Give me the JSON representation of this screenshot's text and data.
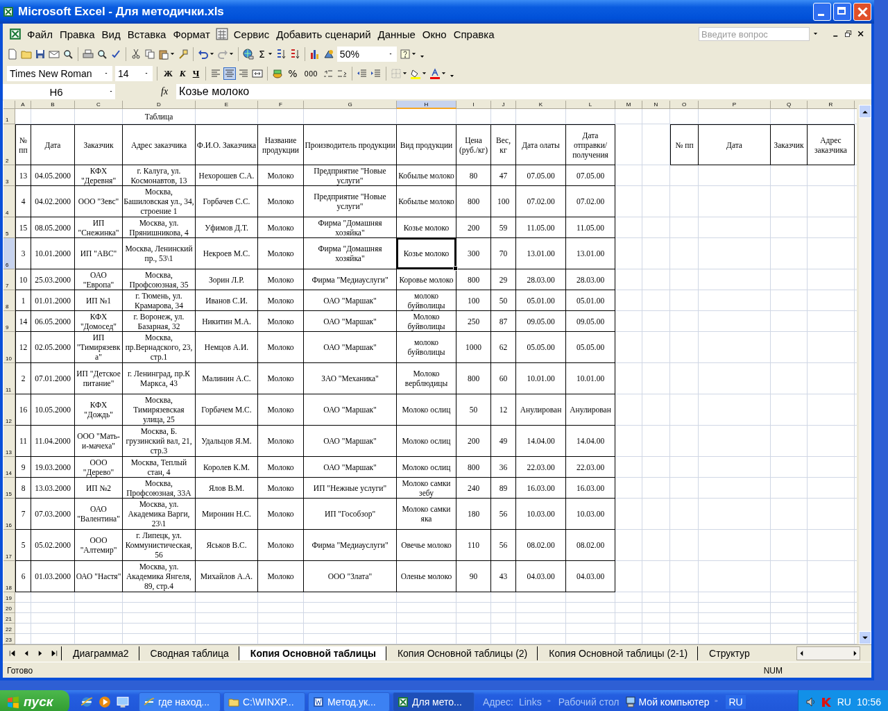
{
  "window": {
    "title": "Microsoft Excel - Для методички.xls"
  },
  "menu": [
    {
      "kind": "item",
      "label": "Файл"
    },
    {
      "kind": "item",
      "label": "Правка"
    },
    {
      "kind": "item",
      "label": "Вид"
    },
    {
      "kind": "item",
      "label": "Вставка"
    },
    {
      "kind": "item",
      "label": "Формат"
    },
    {
      "kind": "icon"
    },
    {
      "kind": "item",
      "label": "Сервис"
    },
    {
      "kind": "item",
      "label": "Добавить сценарий"
    },
    {
      "kind": "item",
      "label": "Данные"
    },
    {
      "kind": "item",
      "label": "Окно"
    },
    {
      "kind": "item",
      "label": "Справка"
    }
  ],
  "help_field": {
    "placeholder": "Введите вопрос"
  },
  "standard_toolbar": {
    "autosum": "Σ",
    "zoom": "50%"
  },
  "formatting_toolbar": {
    "font": "Times New Roman",
    "size": "14",
    "styles": [
      "Ж",
      "К",
      "Ч"
    ],
    "align": [
      {
        "selected": false
      },
      {
        "selected": true
      },
      {
        "selected": false
      }
    ],
    "percent": "%",
    "thousands": "000"
  },
  "formula_bar": {
    "cell": "H6",
    "fx": "fx",
    "value": "Козье молоко"
  },
  "columns": [
    {
      "label": "A",
      "selected": false
    },
    {
      "label": "B",
      "selected": false
    },
    {
      "label": "C",
      "selected": false
    },
    {
      "label": "D",
      "selected": false
    },
    {
      "label": "E",
      "selected": false
    },
    {
      "label": "F",
      "selected": false
    },
    {
      "label": "G",
      "selected": false
    },
    {
      "label": "H",
      "selected": true
    },
    {
      "label": "I",
      "selected": false
    },
    {
      "label": "J",
      "selected": false
    },
    {
      "label": "K",
      "selected": false
    },
    {
      "label": "L",
      "selected": false
    },
    {
      "label": "M",
      "selected": false
    },
    {
      "label": "N",
      "selected": false
    },
    {
      "label": "O",
      "selected": false
    },
    {
      "label": "P",
      "selected": false
    },
    {
      "label": "Q",
      "selected": false
    },
    {
      "label": "R",
      "selected": false
    }
  ],
  "row_numbers": [
    {
      "label": "1",
      "selected": false
    },
    {
      "label": "2",
      "selected": false
    },
    {
      "label": "3",
      "selected": false
    },
    {
      "label": "4",
      "selected": false
    },
    {
      "label": "5",
      "selected": false
    },
    {
      "label": "6",
      "selected": true
    },
    {
      "label": "7",
      "selected": false
    },
    {
      "label": "8",
      "selected": false
    },
    {
      "label": "9",
      "selected": false
    },
    {
      "label": "10",
      "selected": false
    },
    {
      "label": "11",
      "selected": false
    },
    {
      "label": "12",
      "selected": false
    },
    {
      "label": "13",
      "selected": false
    },
    {
      "label": "14",
      "selected": false
    },
    {
      "label": "15",
      "selected": false
    },
    {
      "label": "16",
      "selected": false
    },
    {
      "label": "17",
      "selected": false
    },
    {
      "label": "18",
      "selected": false
    },
    {
      "label": "19",
      "selected": false
    },
    {
      "label": "20",
      "selected": false
    },
    {
      "label": "21",
      "selected": false
    },
    {
      "label": "22",
      "selected": false
    },
    {
      "label": "23",
      "selected": false
    }
  ],
  "sheet": {
    "title": "Таблица",
    "headers": [
      "№ пп",
      "Дата",
      "Заказчик",
      "Адрес заказчика",
      "Ф.И.О. Заказчика",
      "Название продукции",
      "Производитель продукции",
      "Вид продукции",
      "Цена (руб./кг)",
      "Вес, кг",
      "Дата олаты",
      "Дата отправки/получения"
    ],
    "rows": [
      [
        "13",
        "04.05.2000",
        "КФХ \"Деревня\"",
        "г. Калуга, ул. Космонавтов, 13",
        "Нехорошев С.А.",
        "Молоко",
        "Предприятие \"Новые услуги\"",
        "Кобылье молоко",
        "80",
        "47",
        "07.05.00",
        "07.05.00"
      ],
      [
        "4",
        "04.02.2000",
        "ООО \"Зевс\"",
        "Москва, Башиловская ул., 34, строение 1",
        "Горбачев С.С.",
        "Молоко",
        "Предприятие \"Новые услуги\"",
        "Кобылье молоко",
        "800",
        "100",
        "07.02.00",
        "07.02.00"
      ],
      [
        "15",
        "08.05.2000",
        "ИП \"Снежинка\"",
        "Москва, ул. Прянишникова, 4",
        "Уфимов Д.Т.",
        "Молоко",
        "Фирма \"Домашняя хозяйка\"",
        "Козье молоко",
        "200",
        "59",
        "11.05.00",
        "11.05.00"
      ],
      [
        "3",
        "10.01.2000",
        "ИП \"АВС\"",
        "Москва, Ленинский пр., 53\\1",
        "Некроев М.С.",
        "Молоко",
        "Фирма \"Домашняя хозяйка\"",
        "Козье молоко",
        "300",
        "70",
        "13.01.00",
        "13.01.00"
      ],
      [
        "10",
        "25.03.2000",
        "ОАО \"Европа\"",
        "Москва, Профсоюзная, 35",
        "Зорин Л.Р.",
        "Молоко",
        "Фирма \"Медиауслуги\"",
        "Коровье молоко",
        "800",
        "29",
        "28.03.00",
        "28.03.00"
      ],
      [
        "1",
        "01.01.2000",
        "ИП №1",
        "г. Тюмень, ул. Крамарова, 34",
        "Иванов С.И.",
        "Молоко",
        "ОАО \"Маршак\"",
        "молоко буйволицы",
        "100",
        "50",
        "05.01.00",
        "05.01.00"
      ],
      [
        "14",
        "06.05.2000",
        "КФХ \"Домосед\"",
        "г. Воронеж, ул. Базарная, 32",
        "Никитин М.А.",
        "Молоко",
        "ОАО \"Маршак\"",
        "Молоко буйволицы",
        "250",
        "87",
        "09.05.00",
        "09.05.00"
      ],
      [
        "12",
        "02.05.2000",
        "ИП \"Тимирязевка\"",
        "Москва, пр.Вернадского, 23, стр.1",
        "Немцов А.И.",
        "Молоко",
        "ОАО \"Маршак\"",
        "молоко буйволицы",
        "1000",
        "62",
        "05.05.00",
        "05.05.00"
      ],
      [
        "2",
        "07.01.2000",
        "ИП \"Детское питание\"",
        "г. Ленинград, пр.К Маркса, 43",
        "Малинин А.С.",
        "Молоко",
        "ЗАО \"Механика\"",
        "Молоко верблюдицы",
        "800",
        "60",
        "10.01.00",
        "10.01.00"
      ],
      [
        "16",
        "10.05.2000",
        "КФХ \"Дождь\"",
        "Москва, Тимирязевская улица, 25",
        "Горбачем М.С.",
        "Молоко",
        "ОАО \"Маршак\"",
        "Молоко ослиц",
        "50",
        "12",
        "Анулирован",
        "Анулирован"
      ],
      [
        "11",
        "11.04.2000",
        "ООО \"Мать-и-мачеха\"",
        "Москва, Б. грузинский вал, 21, стр.3",
        "Удальцов Я.М.",
        "Молоко",
        "ОАО \"Маршак\"",
        "Молоко ослиц",
        "200",
        "49",
        "14.04.00",
        "14.04.00"
      ],
      [
        "9",
        "19.03.2000",
        "ООО \"Дерево\"",
        "Москва, Теплый стан, 4",
        "Королев К.М.",
        "Молоко",
        "ОАО \"Маршак\"",
        "Молоко ослиц",
        "800",
        "36",
        "22.03.00",
        "22.03.00"
      ],
      [
        "8",
        "13.03.2000",
        "ИП №2",
        "Москва, Профсоюзная, 33А",
        "Ялов В.М.",
        "Молоко",
        "ИП \"Нежные услуги\"",
        "Молоко самки зебу",
        "240",
        "89",
        "16.03.00",
        "16.03.00"
      ],
      [
        "7",
        "07.03.2000",
        "ОАО \"Валентина\"",
        "Москва, ул. Академика Варги, 23\\1",
        "Миронин Н.С.",
        "Молоко",
        "ИП \"Гособзор\"",
        "Молоко самки яка",
        "180",
        "56",
        "10.03.00",
        "10.03.00"
      ],
      [
        "5",
        "05.02.2000",
        "ООО \"Алтемир\"",
        "г. Липецк, ул. Коммунистическая, 56",
        "Яськов В.С.",
        "Молоко",
        "Фирма \"Медиауслуги\"",
        "Овечье молоко",
        "110",
        "56",
        "08.02.00",
        "08.02.00"
      ],
      [
        "6",
        "01.03.2000",
        "ОАО \"Настя\"",
        "Москва, ул. Академика Янгеля, 89, стр.4",
        "Михайлов А.А.",
        "Молоко",
        "ООО \"Злата\"",
        "Оленье молоко",
        "90",
        "43",
        "04.03.00",
        "04.03.00"
      ]
    ],
    "side_headers": [
      "№ пп",
      "Дата",
      "Заказчик",
      "Адрес заказчика"
    ]
  },
  "sheet_tabs": [
    {
      "label": "Диаграмма2",
      "selected": false
    },
    {
      "label": "Сводная таблица",
      "selected": false
    },
    {
      "label": "Копия Основной таблицы",
      "selected": true
    },
    {
      "label": "Копия Основной таблицы (2)",
      "selected": false
    },
    {
      "label": "Копия Основной таблицы (2-1)",
      "selected": false
    },
    {
      "label": "Структур",
      "selected": false
    }
  ],
  "status_bar": {
    "text": "Готово",
    "indicator": "NUM"
  },
  "taskbar": {
    "start": "пуск",
    "tasks": [
      {
        "label": "где наход...",
        "kind": "browser",
        "selected": false
      },
      {
        "label": "C:\\WINXP...",
        "kind": "folder",
        "selected": false
      },
      {
        "label": "Метод.ук...",
        "kind": "word",
        "selected": false
      },
      {
        "label": "Для мето...",
        "kind": "excel",
        "selected": true
      }
    ],
    "address": "Адрес:",
    "links": "Links",
    "desktop": "Рабочий стол",
    "computer": "Мой компьютер",
    "language": "RU",
    "tray_language": "RU",
    "clock": "10:56"
  }
}
